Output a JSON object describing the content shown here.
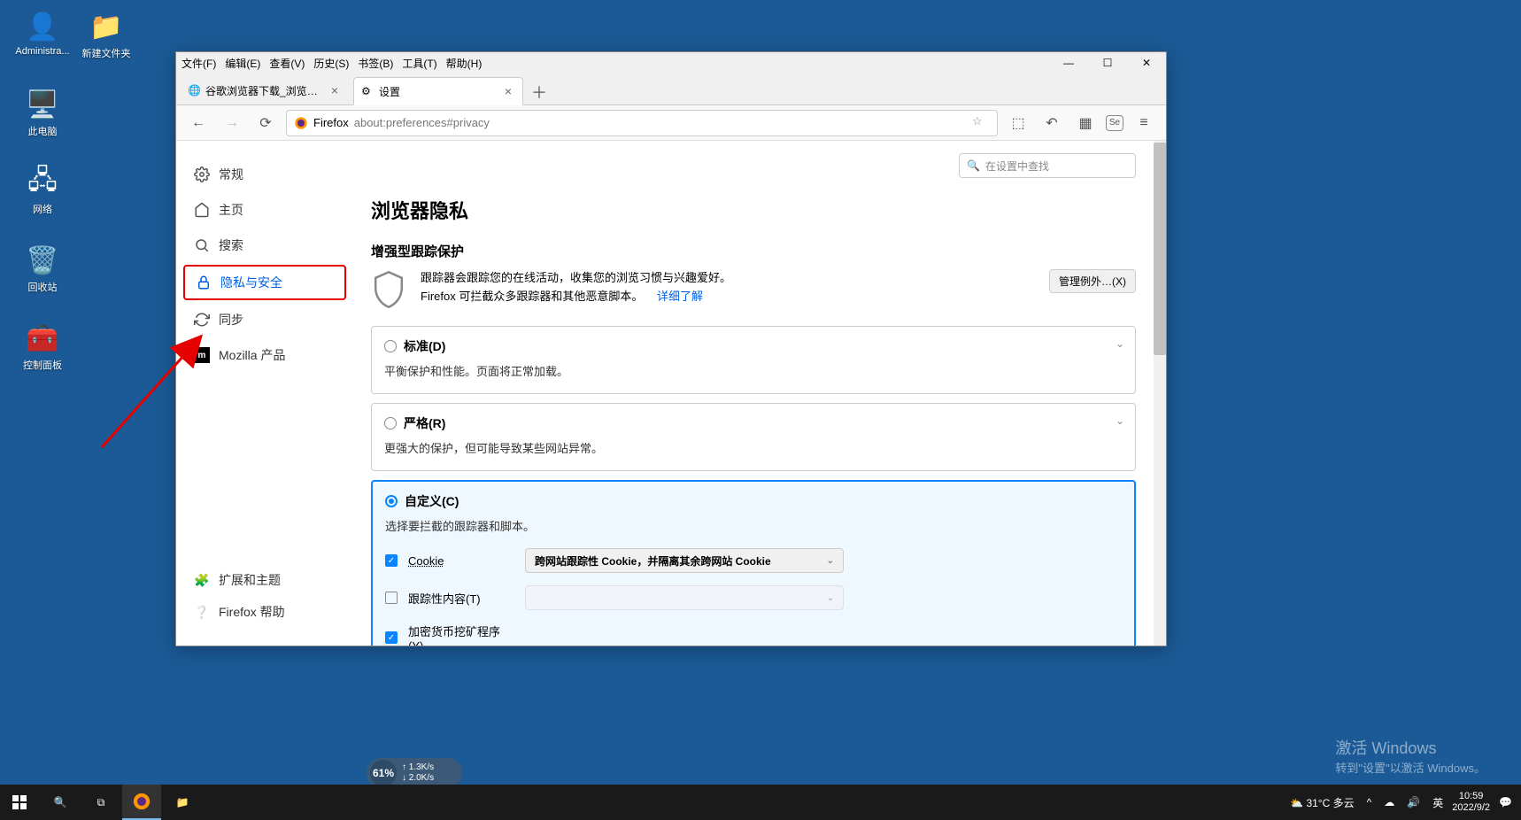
{
  "desktop": {
    "icons": [
      {
        "label": "Administra...",
        "name": "user-icon"
      },
      {
        "label": "新建文件夹",
        "name": "folder-icon"
      },
      {
        "label": "此电脑",
        "name": "this-pc-icon"
      },
      {
        "label": "网络",
        "name": "network-icon"
      },
      {
        "label": "回收站",
        "name": "recycle-bin-icon"
      },
      {
        "label": "控制面板",
        "name": "control-panel-icon"
      }
    ]
  },
  "menubar": [
    "文件(F)",
    "编辑(E)",
    "查看(V)",
    "历史(S)",
    "书签(B)",
    "工具(T)",
    "帮助(H)"
  ],
  "tabs": [
    {
      "title": "谷歌浏览器下载_浏览器官网入口",
      "active": false
    },
    {
      "title": "设置",
      "active": true
    }
  ],
  "urlbar": {
    "label": "Firefox",
    "url": "about:preferences#privacy"
  },
  "search": {
    "placeholder": "在设置中查找"
  },
  "sidebar": {
    "items": [
      {
        "label": "常规",
        "name": "sidebar-item-general"
      },
      {
        "label": "主页",
        "name": "sidebar-item-home"
      },
      {
        "label": "搜索",
        "name": "sidebar-item-search"
      },
      {
        "label": "隐私与安全",
        "name": "sidebar-item-privacy",
        "highlighted": true
      },
      {
        "label": "同步",
        "name": "sidebar-item-sync"
      },
      {
        "label": "Mozilla 产品",
        "name": "sidebar-item-mozilla"
      }
    ],
    "bottom": [
      {
        "label": "扩展和主题",
        "name": "sidebar-item-extensions"
      },
      {
        "label": "Firefox 帮助",
        "name": "sidebar-item-help"
      }
    ]
  },
  "page": {
    "h1": "浏览器隐私",
    "h2": "增强型跟踪保护",
    "intro_line1": "跟踪器会跟踪您的在线活动，收集您的浏览习惯与兴趣爱好。",
    "intro_line2": "Firefox 可拦截众多跟踪器和其他恶意脚本。",
    "learn_more": "详细了解",
    "manage_exceptions": "管理例外…(X)",
    "options": [
      {
        "key": "standard",
        "title": "标准(D)",
        "desc": "平衡保护和性能。页面将正常加载。",
        "checked": false
      },
      {
        "key": "strict",
        "title": "严格(R)",
        "desc": "更强大的保护，但可能导致某些网站异常。",
        "checked": false
      },
      {
        "key": "custom",
        "title": "自定义(C)",
        "desc": "选择要拦截的跟踪器和脚本。",
        "checked": true
      }
    ],
    "custom": {
      "cookie": {
        "label": "Cookie",
        "checked": true,
        "select": "跨网站跟踪性 Cookie，并隔离其余跨网站 Cookie"
      },
      "tracking_content": {
        "label": "跟踪性内容(T)",
        "checked": false,
        "select": ""
      },
      "cryptominer": {
        "label": "加密货币挖矿程序(Y)",
        "checked": true
      }
    }
  },
  "speed": {
    "pct": "61%",
    "up": "1.3K/s",
    "down": "2.0K/s"
  },
  "watermark": {
    "l1": "激活 Windows",
    "l2": "转到\"设置\"以激活 Windows。"
  },
  "taskbar": {
    "weather": "31°C 多云",
    "ime": "英",
    "time": "10:59",
    "date": "2022/9/2"
  }
}
